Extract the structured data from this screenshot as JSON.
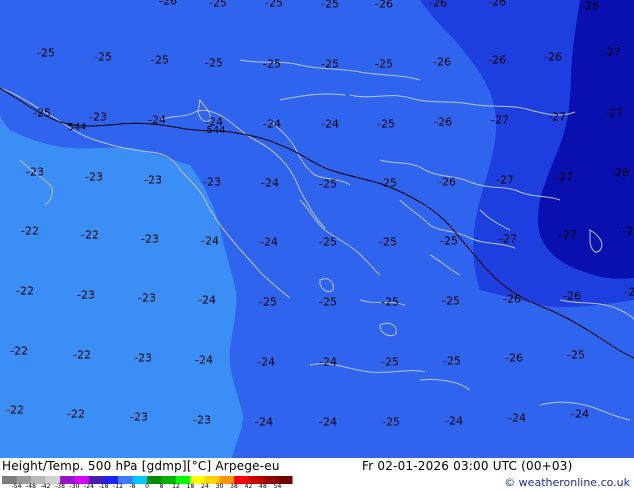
{
  "footer": {
    "title": "Height/Temp. 500 hPa [gdmp][°C] Arpege-eu",
    "datetime": "Fr 02-01-2026 03:00 UTC (00+03)",
    "copyright": "© weatheronline.co.uk"
  },
  "colors": {
    "band_minus22": "#3a8ef6",
    "band_minus24": "#2f64ee",
    "band_minus26": "#1e3fe0",
    "band_minus28": "#0a0fb0",
    "coast": "#b8c3d8",
    "contour_line": "#000000"
  },
  "colorbar": {
    "ticks": [
      "-54",
      "-48",
      "-42",
      "-38",
      "-30",
      "-24",
      "-18",
      "-12",
      "-8",
      "0",
      "8",
      "12",
      "18",
      "24",
      "30",
      "38",
      "42",
      "48",
      "54"
    ],
    "colors": [
      "#7c7c7c",
      "#9b9b9b",
      "#b9b9b9",
      "#d2d2d2",
      "#9a14c8",
      "#d800ff",
      "#4a1eaa",
      "#1d23ff",
      "#3d7bff",
      "#00c8ff",
      "#008a00",
      "#00b400",
      "#00ff00",
      "#ffff00",
      "#ffd200",
      "#ff9600",
      "#ff0000",
      "#c80000",
      "#960000",
      "#6e0000"
    ]
  },
  "height_labels": [
    "544",
    "544"
  ],
  "temp_labels": [
    "-26",
    "-25",
    "-25",
    "-25",
    "-26",
    "-26",
    "-26",
    "-26",
    "-25",
    "-25",
    "-25",
    "-25",
    "-25",
    "-25",
    "-25",
    "-26",
    "-26",
    "-26",
    "-27",
    "-25",
    "-23",
    "-24",
    "-24",
    "-24",
    "-24",
    "-25",
    "-26",
    "-27",
    "-27",
    "-27",
    "-23",
    "-23",
    "-23",
    "-23",
    "-24",
    "-25",
    "-25",
    "-26",
    "-27",
    "-27",
    "-28",
    "-22",
    "-22",
    "-23",
    "-24",
    "-24",
    "-25",
    "-25",
    "-25",
    "-27",
    "-27",
    "-2",
    "-22",
    "-23",
    "-23",
    "-24",
    "-25",
    "-25",
    "-25",
    "-25",
    "-26",
    "-26",
    "-2",
    "-22",
    "-22",
    "-23",
    "-24",
    "-24",
    "-24",
    "-25",
    "-25",
    "-26",
    "-25",
    "-22",
    "-22",
    "-23",
    "-23",
    "-24",
    "-24",
    "-25",
    "-24",
    "-24",
    "-24"
  ]
}
